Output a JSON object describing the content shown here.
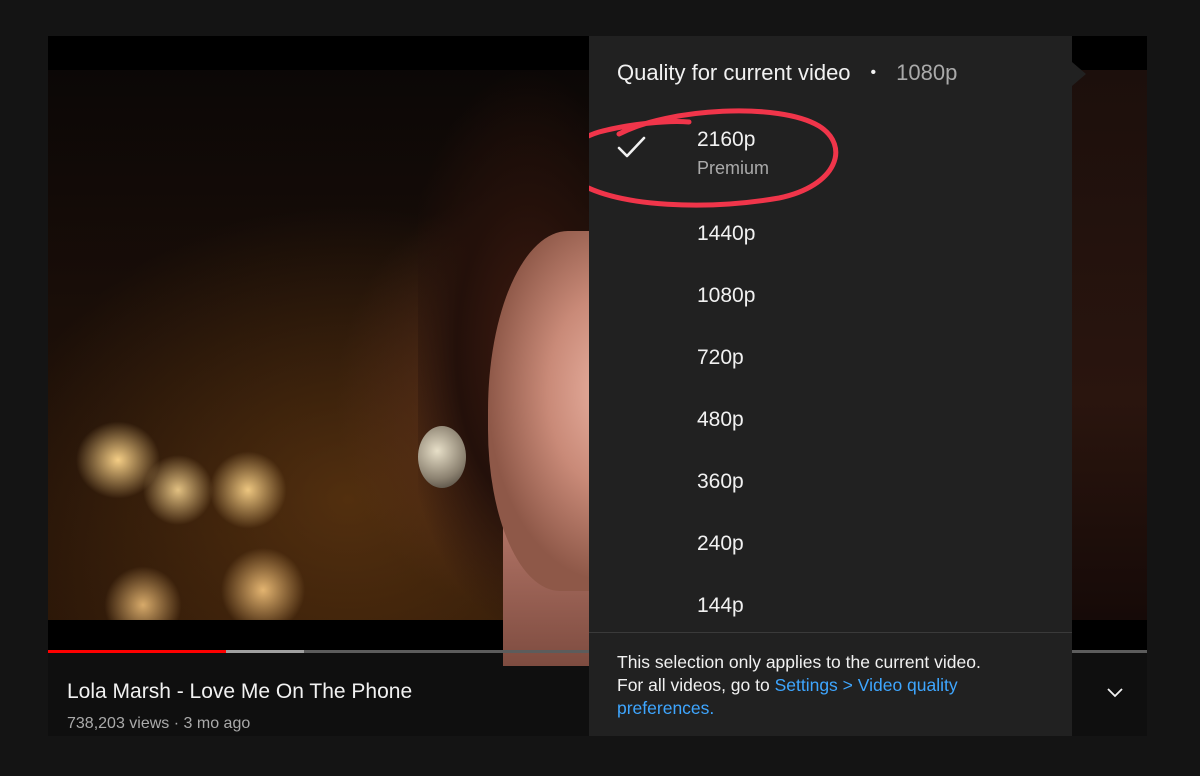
{
  "video": {
    "title": "Lola Marsh - Love Me On The Phone",
    "views": "738,203 views",
    "separator": "·",
    "age": "3 mo ago",
    "progress_played_fraction": 0.162,
    "progress_buffered_fraction": 0.233
  },
  "quality_menu": {
    "header_label": "Quality for current video",
    "header_dot": "•",
    "current_quality": "1080p",
    "options": [
      {
        "label": "2160p",
        "sublabel": "Premium",
        "selected": true
      },
      {
        "label": "1440p"
      },
      {
        "label": "1080p"
      },
      {
        "label": "720p"
      },
      {
        "label": "480p"
      },
      {
        "label": "360p"
      },
      {
        "label": "240p"
      },
      {
        "label": "144p"
      }
    ],
    "footer": {
      "text_line1": "This selection only applies to the current video.",
      "text_line2_prefix": "For all videos, go to ",
      "link_text": "Settings > Video quality preferences."
    }
  },
  "colors": {
    "menu_bg": "#212121",
    "progress_red": "#ff0000",
    "link_blue": "#3ea6ff",
    "annotation_red": "#f0354a"
  },
  "icons": {
    "selected_mark": "check-icon",
    "expand": "chevron-down-icon"
  }
}
